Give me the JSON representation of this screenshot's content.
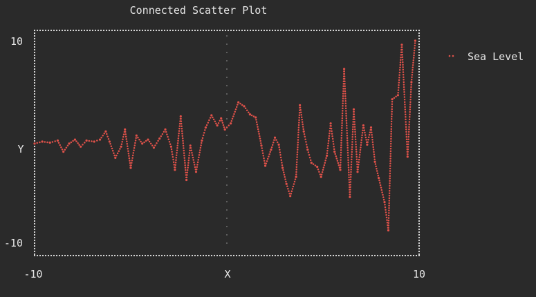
{
  "chart_data": {
    "type": "line",
    "title": "Connected Scatter Plot",
    "xlabel": "X",
    "ylabel": "Y",
    "xlim": [
      -10,
      10
    ],
    "ylim": [
      -10,
      10
    ],
    "x_ticks": [
      "-10",
      "10"
    ],
    "y_ticks": [
      "10",
      "-10"
    ],
    "grid": false,
    "legend_position": "right",
    "series": [
      {
        "name": "Sea Level",
        "color": "#e0524a",
        "marker": "braille-dots",
        "points": [
          [
            -10.0,
            -0.2
          ],
          [
            -9.6,
            0.0
          ],
          [
            -9.2,
            -0.1
          ],
          [
            -8.8,
            0.1
          ],
          [
            -8.5,
            -1.0
          ],
          [
            -8.2,
            -0.2
          ],
          [
            -7.9,
            0.2
          ],
          [
            -7.6,
            -0.5
          ],
          [
            -7.3,
            0.1
          ],
          [
            -6.9,
            0.0
          ],
          [
            -6.6,
            0.2
          ],
          [
            -6.3,
            1.0
          ],
          [
            -6.1,
            0.0
          ],
          [
            -5.8,
            -1.6
          ],
          [
            -5.5,
            -0.5
          ],
          [
            -5.3,
            1.2
          ],
          [
            -5.0,
            -2.6
          ],
          [
            -4.7,
            0.6
          ],
          [
            -4.4,
            -0.2
          ],
          [
            -4.1,
            0.2
          ],
          [
            -3.8,
            -0.6
          ],
          [
            -3.5,
            0.3
          ],
          [
            -3.2,
            1.2
          ],
          [
            -2.9,
            -0.5
          ],
          [
            -2.7,
            -2.8
          ],
          [
            -2.4,
            2.5
          ],
          [
            -2.1,
            -3.8
          ],
          [
            -1.9,
            -0.4
          ],
          [
            -1.6,
            -3.0
          ],
          [
            -1.3,
            0.1
          ],
          [
            -1.1,
            1.4
          ],
          [
            -0.8,
            2.6
          ],
          [
            -0.5,
            1.6
          ],
          [
            -0.3,
            2.3
          ],
          [
            -0.1,
            1.2
          ],
          [
            0.2,
            1.8
          ],
          [
            0.6,
            3.9
          ],
          [
            0.9,
            3.5
          ],
          [
            1.2,
            2.7
          ],
          [
            1.5,
            2.4
          ],
          [
            1.8,
            -0.4
          ],
          [
            2.0,
            -2.4
          ],
          [
            2.3,
            -0.8
          ],
          [
            2.5,
            0.4
          ],
          [
            2.7,
            -0.3
          ],
          [
            2.9,
            -2.6
          ],
          [
            3.1,
            -4.2
          ],
          [
            3.3,
            -5.4
          ],
          [
            3.6,
            -3.5
          ],
          [
            3.8,
            3.6
          ],
          [
            4.0,
            1.0
          ],
          [
            4.2,
            -0.8
          ],
          [
            4.4,
            -2.1
          ],
          [
            4.7,
            -2.5
          ],
          [
            4.9,
            -3.5
          ],
          [
            5.2,
            -1.4
          ],
          [
            5.4,
            1.8
          ],
          [
            5.6,
            -1.0
          ],
          [
            5.9,
            -2.8
          ],
          [
            6.1,
            7.2
          ],
          [
            6.4,
            -5.5
          ],
          [
            6.6,
            3.2
          ],
          [
            6.8,
            -3.0
          ],
          [
            7.1,
            1.6
          ],
          [
            7.3,
            -0.3
          ],
          [
            7.5,
            1.4
          ],
          [
            7.7,
            -2.0
          ],
          [
            7.9,
            -3.6
          ],
          [
            8.2,
            -6.0
          ],
          [
            8.4,
            -8.8
          ],
          [
            8.6,
            4.2
          ],
          [
            8.9,
            4.6
          ],
          [
            9.1,
            9.6
          ],
          [
            9.4,
            -1.5
          ],
          [
            9.6,
            5.9
          ],
          [
            9.8,
            10.0
          ]
        ]
      }
    ]
  }
}
